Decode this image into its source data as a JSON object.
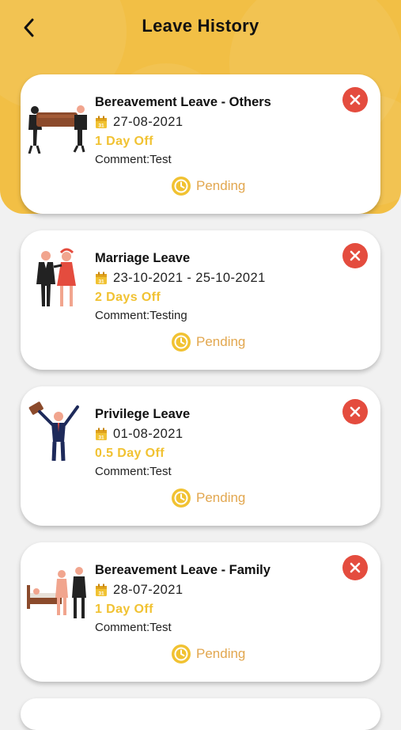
{
  "header": {
    "title": "Leave History"
  },
  "leaves": [
    {
      "type": "Bereavement Leave - Others",
      "date": "27-08-2021",
      "days_off": "1 Day Off",
      "comment": "Comment:Test",
      "status": "Pending"
    },
    {
      "type": "Marriage Leave",
      "date": "23-10-2021 - 25-10-2021",
      "days_off": "2 Days Off",
      "comment": "Comment:Testing",
      "status": "Pending"
    },
    {
      "type": "Privilege Leave",
      "date": "01-08-2021",
      "days_off": "0.5 Day Off",
      "comment": "Comment:Test",
      "status": "Pending"
    },
    {
      "type": "Bereavement Leave - Family",
      "date": "28-07-2021",
      "days_off": "1 Day Off",
      "comment": "Comment:Test",
      "status": "Pending"
    }
  ],
  "icons": {
    "back": "chevron-left-icon",
    "calendar": "calendar-icon",
    "status": "clock-icon",
    "cancel": "close-icon"
  },
  "colors": {
    "header": "#f2bf45",
    "days_off": "#f1c232",
    "status": "#e2a74f",
    "cancel": "#e44c3e"
  }
}
